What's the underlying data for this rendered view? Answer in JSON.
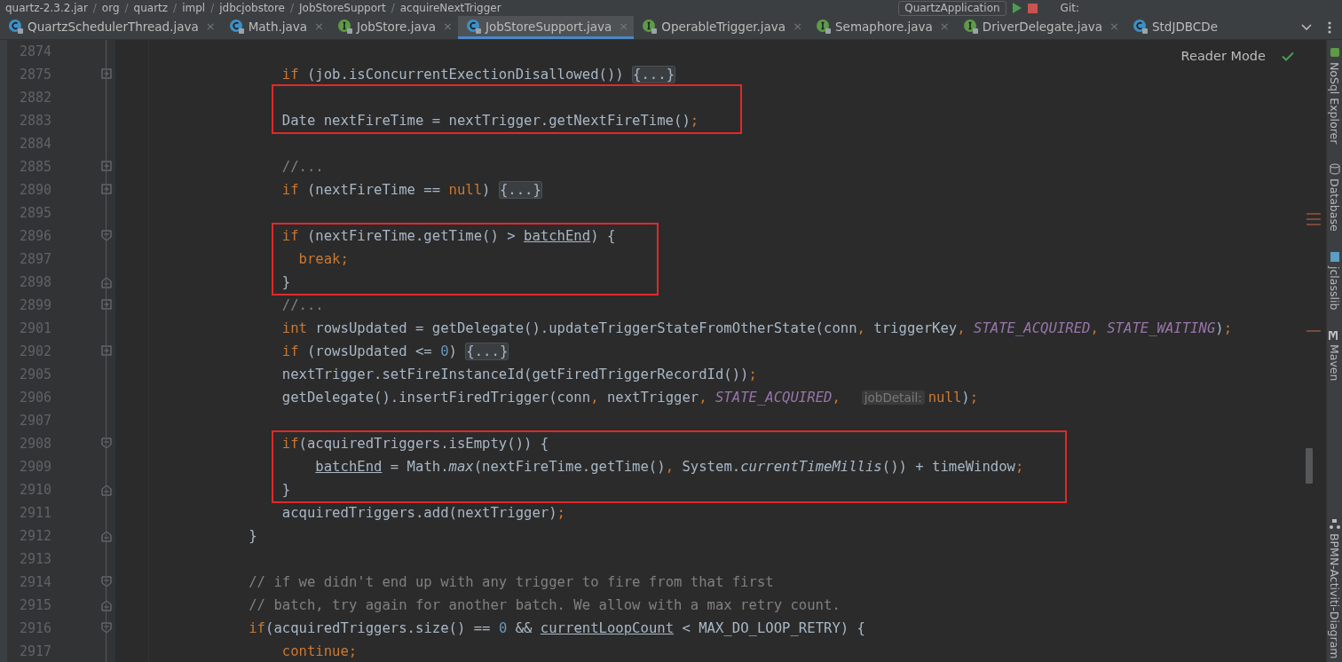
{
  "breadcrumb": [
    {
      "label": "quartz-2.3.2.jar"
    },
    {
      "separator": "/",
      "label": "org"
    },
    {
      "separator": "/",
      "label": "quartz"
    },
    {
      "separator": "/",
      "label": "impl"
    },
    {
      "separator": "/",
      "label": "jdbcjobstore"
    },
    {
      "separator": "/",
      "label": "JobStoreSupport"
    },
    {
      "separator": "/",
      "label": "acquireNextTrigger"
    }
  ],
  "toolbar": {
    "run_config": "QuartzApplication",
    "vcs_label": "Git:"
  },
  "tabs": [
    {
      "label": "QuartzSchedulerThread.java",
      "kind": "class",
      "selected": false,
      "close": "×"
    },
    {
      "label": "Math.java",
      "kind": "class",
      "selected": false,
      "close": "×"
    },
    {
      "label": "JobStore.java",
      "kind": "interface",
      "selected": false,
      "close": "×"
    },
    {
      "label": "JobStoreSupport.java",
      "kind": "class",
      "selected": true,
      "close": "×"
    },
    {
      "label": "OperableTrigger.java",
      "kind": "interface",
      "selected": false,
      "close": "×"
    },
    {
      "label": "Semaphore.java",
      "kind": "interface",
      "selected": false,
      "close": "×"
    },
    {
      "label": "DriverDelegate.java",
      "kind": "interface",
      "selected": false,
      "close": "×"
    },
    {
      "label": "StdJDBCDe",
      "kind": "class",
      "selected": false
    }
  ],
  "reader_mode": "Reader Mode",
  "lines": [
    {
      "num": "2874",
      "boxed": false
    },
    {
      "num": "2875",
      "fold_marker": {
        "kind": "expand"
      },
      "boxed": false,
      "tokens": [
        {
          "kind": "kw",
          "text": "                    if"
        },
        {
          "kind": "plain",
          "text": " (job.isConcurrentExectionDisallowed()) "
        },
        {
          "kind": "folded",
          "text": "{...}"
        }
      ]
    },
    {
      "num": "2882",
      "boxed": true
    },
    {
      "num": "2883",
      "boxed": true,
      "tokens": [
        {
          "kind": "plain",
          "text": "                    Date nextFireTime = nextTrigger.getNextFireTime()"
        },
        {
          "kind": "kw",
          "text": ";"
        }
      ]
    },
    {
      "num": "2884",
      "boxed": false
    },
    {
      "num": "2885",
      "fold_marker": {
        "kind": "expand"
      },
      "boxed": false,
      "tokens": [
        {
          "kind": "comment",
          "text": "                    //..."
        }
      ]
    },
    {
      "num": "2890",
      "fold_marker": {
        "kind": "expand"
      },
      "boxed": false,
      "tokens": [
        {
          "kind": "kw",
          "text": "                    if"
        },
        {
          "kind": "plain",
          "text": " (nextFireTime == "
        },
        {
          "kind": "kw",
          "text": "null"
        },
        {
          "kind": "plain",
          "text": ") "
        },
        {
          "kind": "folded",
          "text": "{...}"
        }
      ]
    },
    {
      "num": "2895",
      "boxed": false
    },
    {
      "num": "2896",
      "fold_marker": {
        "kind": "start"
      },
      "boxed": true,
      "tokens": [
        {
          "kind": "kw",
          "text": "                    if"
        },
        {
          "kind": "plain",
          "text": " (nextFireTime.getTime() > "
        },
        {
          "kind": "field",
          "text": "batchEnd"
        },
        {
          "kind": "plain",
          "text": ") {"
        }
      ]
    },
    {
      "num": "2897",
      "boxed": true,
      "tokens": [
        {
          "kind": "kw",
          "text": "                      break;"
        }
      ]
    },
    {
      "num": "2898",
      "fold_marker": {
        "kind": "end"
      },
      "boxed": true,
      "tokens": [
        {
          "kind": "plain",
          "text": "                    }"
        }
      ]
    },
    {
      "num": "2899",
      "fold_marker": {
        "kind": "expand"
      },
      "boxed": false,
      "tokens": [
        {
          "kind": "comment",
          "text": "                    //..."
        }
      ]
    },
    {
      "num": "2901",
      "boxed": false,
      "tokens": [
        {
          "kind": "kw",
          "text": "                    int"
        },
        {
          "kind": "plain",
          "text": " rowsUpdated = getDelegate().updateTriggerStateFromOtherState(conn"
        },
        {
          "kind": "kw",
          "text": ","
        },
        {
          "kind": "plain",
          "text": " triggerKey"
        },
        {
          "kind": "kw",
          "text": ","
        },
        {
          "kind": "const",
          "text": " STATE_ACQUIRED"
        },
        {
          "kind": "kw",
          "text": ","
        },
        {
          "kind": "const",
          "text": " STATE_WAITING"
        },
        {
          "kind": "plain",
          "text": ")"
        },
        {
          "kind": "kw",
          "text": ";"
        }
      ]
    },
    {
      "num": "2902",
      "fold_marker": {
        "kind": "expand"
      },
      "boxed": false,
      "tokens": [
        {
          "kind": "kw",
          "text": "                    if"
        },
        {
          "kind": "plain",
          "text": " (rowsUpdated <= "
        },
        {
          "kind": "num",
          "text": "0"
        },
        {
          "kind": "plain",
          "text": ") "
        },
        {
          "kind": "folded",
          "text": "{...}"
        }
      ]
    },
    {
      "num": "2905",
      "boxed": false,
      "tokens": [
        {
          "kind": "plain",
          "text": "                    nextTrigger.setFireInstanceId(getFiredTriggerRecordId())"
        },
        {
          "kind": "kw",
          "text": ";"
        }
      ]
    },
    {
      "num": "2906",
      "boxed": false,
      "tokens": [
        {
          "kind": "plain",
          "text": "                    getDelegate().insertFiredTrigger(conn"
        },
        {
          "kind": "kw",
          "text": ","
        },
        {
          "kind": "plain",
          "text": " nextTrigger"
        },
        {
          "kind": "kw",
          "text": ","
        },
        {
          "kind": "const",
          "text": " STATE_ACQUIRED"
        },
        {
          "kind": "kw",
          "text": ","
        },
        {
          "kind": "hint",
          "text": "jobDetail:"
        },
        {
          "kind": "kw",
          "text": "null"
        },
        {
          "kind": "plain",
          "text": ")"
        },
        {
          "kind": "kw",
          "text": ";"
        }
      ]
    },
    {
      "num": "2907",
      "boxed": false
    },
    {
      "num": "2908",
      "fold_marker": {
        "kind": "start"
      },
      "boxed": true,
      "tokens": [
        {
          "kind": "kw",
          "text": "                    if"
        },
        {
          "kind": "plain",
          "text": "(acquiredTriggers.isEmpty()) {"
        }
      ]
    },
    {
      "num": "2909",
      "boxed": true,
      "tokens": [
        {
          "kind": "field",
          "text": "                        batchEnd"
        },
        {
          "kind": "plain",
          "text": " = Math."
        },
        {
          "kind": "static",
          "text": "max"
        },
        {
          "kind": "plain",
          "text": "(nextFireTime.getTime()"
        },
        {
          "kind": "kw",
          "text": ","
        },
        {
          "kind": "plain",
          "text": " System."
        },
        {
          "kind": "static",
          "text": "currentTimeMillis"
        },
        {
          "kind": "plain",
          "text": "()) + timeWindow"
        },
        {
          "kind": "kw",
          "text": ";"
        }
      ]
    },
    {
      "num": "2910",
      "fold_marker": {
        "kind": "end"
      },
      "boxed": true,
      "tokens": [
        {
          "kind": "plain",
          "text": "                    }"
        }
      ]
    },
    {
      "num": "2911",
      "boxed": false,
      "tokens": [
        {
          "kind": "plain",
          "text": "                    acquiredTriggers.add(nextTrigger)"
        },
        {
          "kind": "kw",
          "text": ";"
        }
      ]
    },
    {
      "num": "2912",
      "fold_marker": {
        "kind": "end"
      },
      "boxed": false,
      "tokens": [
        {
          "kind": "plain",
          "text": "                }"
        }
      ]
    },
    {
      "num": "2913",
      "boxed": false
    },
    {
      "num": "2914",
      "fold_marker": {
        "kind": "start"
      },
      "boxed": false,
      "tokens": [
        {
          "kind": "comment",
          "text": "                // if we didn't end up with any trigger to fire from that first"
        }
      ]
    },
    {
      "num": "2915",
      "fold_marker": {
        "kind": "end"
      },
      "boxed": false,
      "tokens": [
        {
          "kind": "comment",
          "text": "                // batch, try again for another batch. We allow with a max retry count."
        }
      ]
    },
    {
      "num": "2916",
      "fold_marker": {
        "kind": "start"
      },
      "boxed": false,
      "tokens": [
        {
          "kind": "kw",
          "text": "                if"
        },
        {
          "kind": "plain",
          "text": "(acquiredTriggers.size() == "
        },
        {
          "kind": "num",
          "text": "0"
        },
        {
          "kind": "plain",
          "text": " && "
        },
        {
          "kind": "field",
          "text": "currentLoopCount"
        },
        {
          "kind": "plain",
          "text": " < MAX_DO_LOOP_RETRY) {"
        }
      ]
    },
    {
      "num": "2917",
      "boxed": false,
      "tokens": [
        {
          "kind": "kw",
          "text": "                    continue;"
        }
      ]
    }
  ],
  "side_tools": [
    {
      "label": "NoSql Explorer"
    },
    {
      "label": "Database"
    },
    {
      "label": "jclasslib"
    },
    {
      "label": "Maven"
    },
    {
      "label": "BPMN-Activiti-Diagram"
    }
  ]
}
